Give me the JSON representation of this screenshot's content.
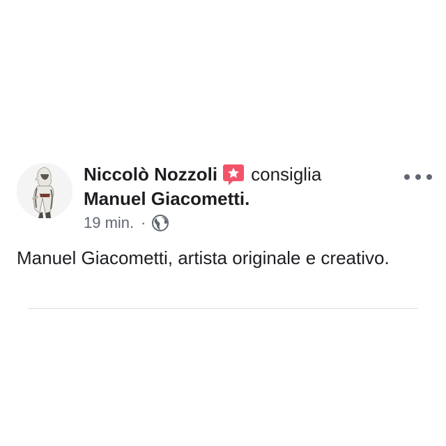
{
  "post": {
    "author": "Niccolò Nozzoli",
    "badge_icon": "recommendation-star-icon",
    "action": "consiglia",
    "target": "Manuel Giacometti.",
    "time": "19 min.",
    "separator": "·",
    "privacy_icon": "globe-icon",
    "more_icon": "more-options-icon",
    "text": "Manuel Giacometti, artista originale e creativo."
  },
  "colors": {
    "text": "#1c1e21",
    "meta": "#606770",
    "badge": "#f35369",
    "divider": "#dadde1"
  }
}
